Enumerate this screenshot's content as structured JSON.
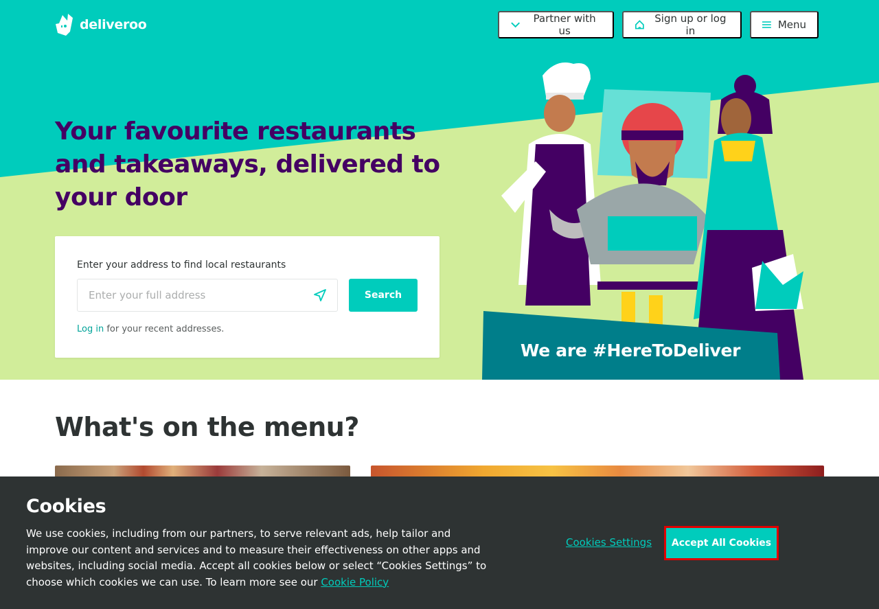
{
  "brand": {
    "name": "deliveroo"
  },
  "header": {
    "partner_label": "Partner with us",
    "signup_label": "Sign up or log in",
    "menu_label": "Menu"
  },
  "hero": {
    "headline": "Your favourite restaurants and takeaways, delivered to your door",
    "search_label": "Enter your address to find local restaurants",
    "address_placeholder": "Enter your full address",
    "search_button": "Search",
    "login_link": "Log in",
    "login_suffix": " for your recent addresses.",
    "banner_text": "We are #HereToDeliver"
  },
  "menu_section": {
    "title": "What's on the menu?"
  },
  "cookies": {
    "title": "Cookies",
    "body": "We use cookies, including from our partners, to serve relevant ads, help tailor and improve our content and services and to measure their effectiveness on other apps and websites, including social media. Accept all cookies below or select “Cookies Settings” to choose which cookies we can use. To learn more see our ",
    "policy_link": "Cookie Policy",
    "settings_label": "Cookies Settings",
    "accept_label": "Accept All Cookies"
  },
  "colors": {
    "teal": "#00ccbc",
    "lime": "#d1ed9a",
    "purple": "#440063",
    "dark": "#2e3333",
    "highlight_outline": "#e00000"
  },
  "icons": {
    "partner": "chevron-down-icon",
    "signup": "home-icon",
    "menu": "hamburger-icon",
    "locate": "location-arrow-icon"
  }
}
